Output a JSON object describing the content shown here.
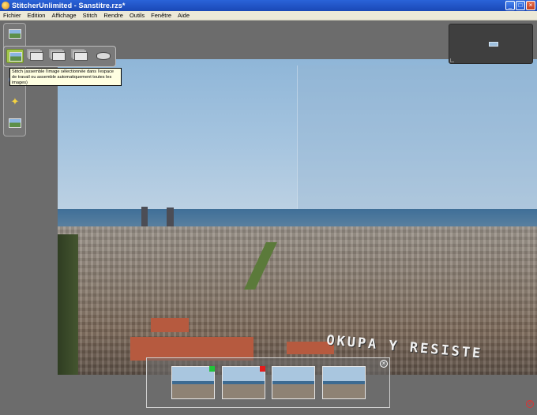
{
  "window": {
    "title": "StitcherUnlimited - Sanstitre.rzs*",
    "minimize_glyph": "_",
    "maximize_glyph": "□",
    "close_glyph": "×"
  },
  "menu": [
    "Fichier",
    "Edition",
    "Affichage",
    "Stitch",
    "Rendre",
    "Outils",
    "Fenêtre",
    "Aide"
  ],
  "tooltip": {
    "text": "Stitch (assemble l'image sélectionnée dans l'espace de travail ou assemble automatiquement toutes les images)"
  },
  "canvas": {
    "graffiti": "OKUPA Y RESISTE"
  },
  "tools": {
    "vertical": [
      "open-images-icon",
      "sphere-icon",
      "magic-star-icon",
      "image-settings-icon"
    ],
    "horizontal": [
      "stitch-icon",
      "stack-icon-1",
      "stack-icon-2",
      "stack-icon-3",
      "panorama-icon"
    ]
  },
  "filmstrip": {
    "close_glyph": "×",
    "thumbnails": [
      {
        "status_color": "#22c33a"
      },
      {
        "status_color": "#e41c1c"
      },
      {
        "status_color": ""
      },
      {
        "status_color": ""
      }
    ]
  },
  "colors": {
    "titlebar": "#2a63d8",
    "menubar": "#ece9d8",
    "workspace": "#6c6c6c",
    "active_tool": "#a2c64b",
    "tooltip_bg": "#ffffe1"
  }
}
